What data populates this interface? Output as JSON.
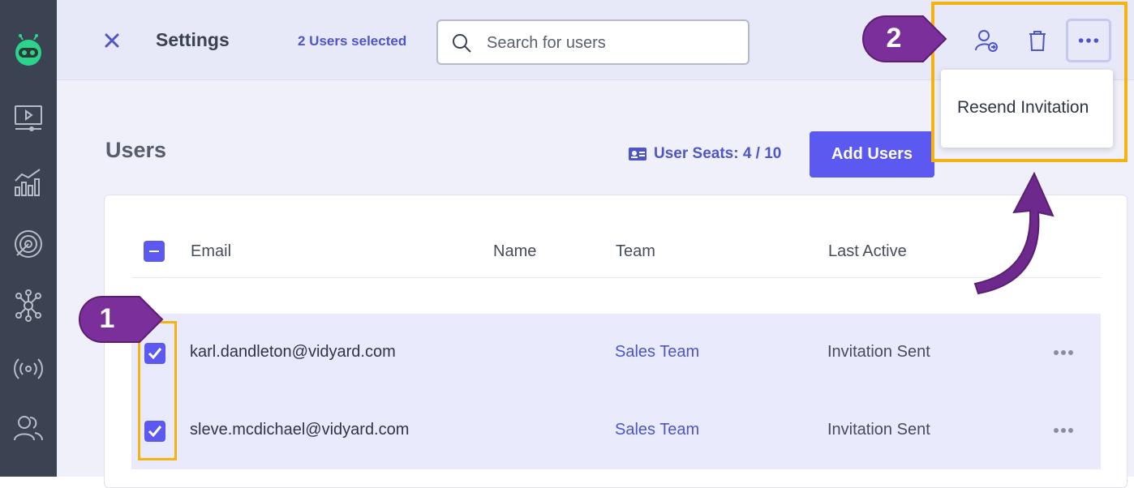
{
  "header": {
    "title": "Settings",
    "selected_count": "2 Users selected",
    "search_placeholder": "Search for users"
  },
  "actions_menu": {
    "items": [
      "Resend Invitation"
    ]
  },
  "users": {
    "title": "Users",
    "seats_label": "User Seats: 4 / 10",
    "add_button": "Add Users",
    "columns": [
      "Email",
      "Name",
      "Team",
      "Last Active"
    ],
    "rows": [
      {
        "email": "karl.dandleton@vidyard.com",
        "name": "",
        "team": "Sales Team",
        "last_active": "Invitation Sent",
        "checked": true
      },
      {
        "email": "sleve.mcdichael@vidyard.com",
        "name": "",
        "team": "Sales Team",
        "last_active": "Invitation Sent",
        "checked": true
      }
    ]
  },
  "callouts": {
    "step_1": "1",
    "step_2": "2"
  },
  "colors": {
    "accent": "#5b59f0",
    "link": "#4e55c9",
    "highlight": "#f5b312",
    "callout": "#7b2f9a",
    "sidebar": "#3b4252"
  }
}
